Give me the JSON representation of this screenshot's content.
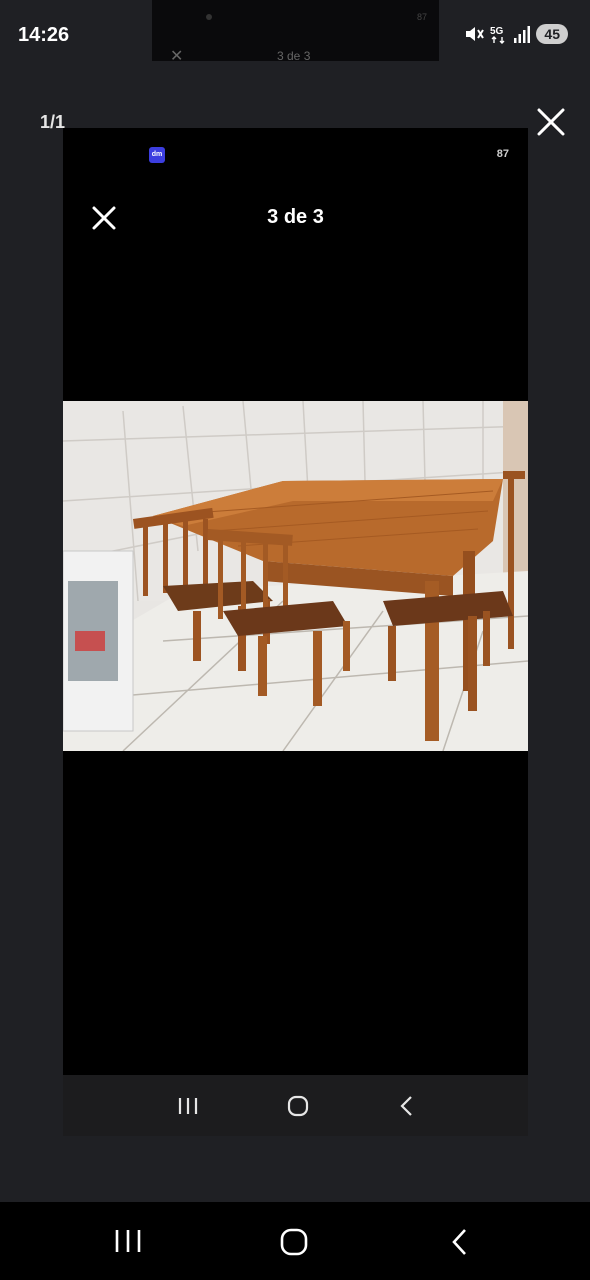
{
  "status_bar": {
    "time": "14:26",
    "network": "5G",
    "battery": "45"
  },
  "background_tab": {
    "title": "3 de 3",
    "corner_number": "87"
  },
  "viewer": {
    "page_counter": "1/1"
  },
  "inner_screen": {
    "app_icon_label": "dm",
    "corner_number": "87",
    "title": "3 de 3"
  },
  "colors": {
    "background": "#1f2024",
    "viewer_black": "#000000",
    "app_icon": "#3c3ee0",
    "battery_pill": "#cfcfcf"
  },
  "icons": {
    "outer_close": "close-icon",
    "inner_close": "close-icon",
    "recents": "recents-icon",
    "home": "home-icon",
    "back": "back-icon"
  }
}
